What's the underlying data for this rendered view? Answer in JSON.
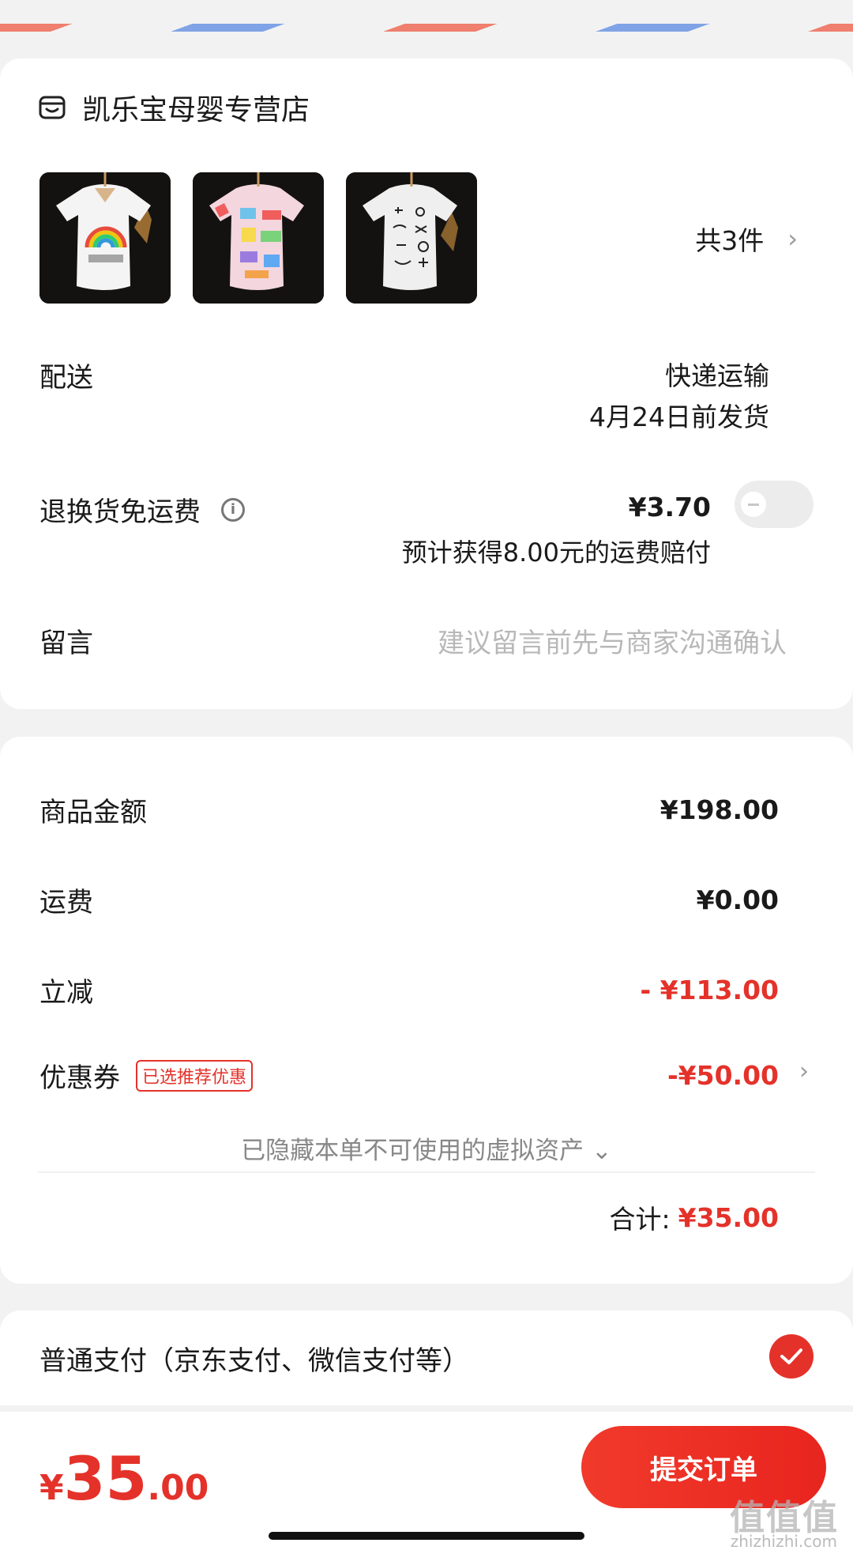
{
  "colors": {
    "accent": "#e4322a",
    "background": "#f2f2f2",
    "card": "#ffffff"
  },
  "store": {
    "icon": "store-icon",
    "name": "凯乐宝母婴专营店"
  },
  "products": {
    "items": [
      {
        "name": "rainbow-tshirt"
      },
      {
        "name": "colorful-print-tshirt"
      },
      {
        "name": "doodle-print-tshirt"
      }
    ],
    "count_label": "共3件",
    "chevron": "›"
  },
  "delivery": {
    "label": "配送",
    "method": "快递运输",
    "ship_date": "4月24日前发货"
  },
  "return_shipping": {
    "label": "退换货免运费",
    "info_icon": "i",
    "price": "¥3.70",
    "note": "预计获得8.00元的运费赔付",
    "toggle_on": false
  },
  "message": {
    "label": "留言",
    "placeholder": "建议留言前先与商家沟通确认"
  },
  "summary": {
    "goods_label": "商品金额",
    "goods_value": "¥198.00",
    "shipping_label": "运费",
    "shipping_value": "¥0.00",
    "discount_label": "立减",
    "discount_value": "- ¥113.00",
    "coupon_label": "优惠券",
    "coupon_tag": "已选推荐优惠",
    "coupon_value": "-¥50.00",
    "hidden_assets": "已隐藏本单不可使用的虚拟资产 ⌄",
    "total_label": "合计:",
    "total_value": "¥35.00"
  },
  "payment": {
    "label": "普通支付（京东支付、微信支付等）",
    "selected": true
  },
  "bottom": {
    "price_currency": "¥",
    "price_int": "35",
    "price_dec": ".00",
    "submit_label": "提交订单",
    "watermark_cjk": "值值值",
    "watermark_url": "zhizhizhi.com"
  }
}
